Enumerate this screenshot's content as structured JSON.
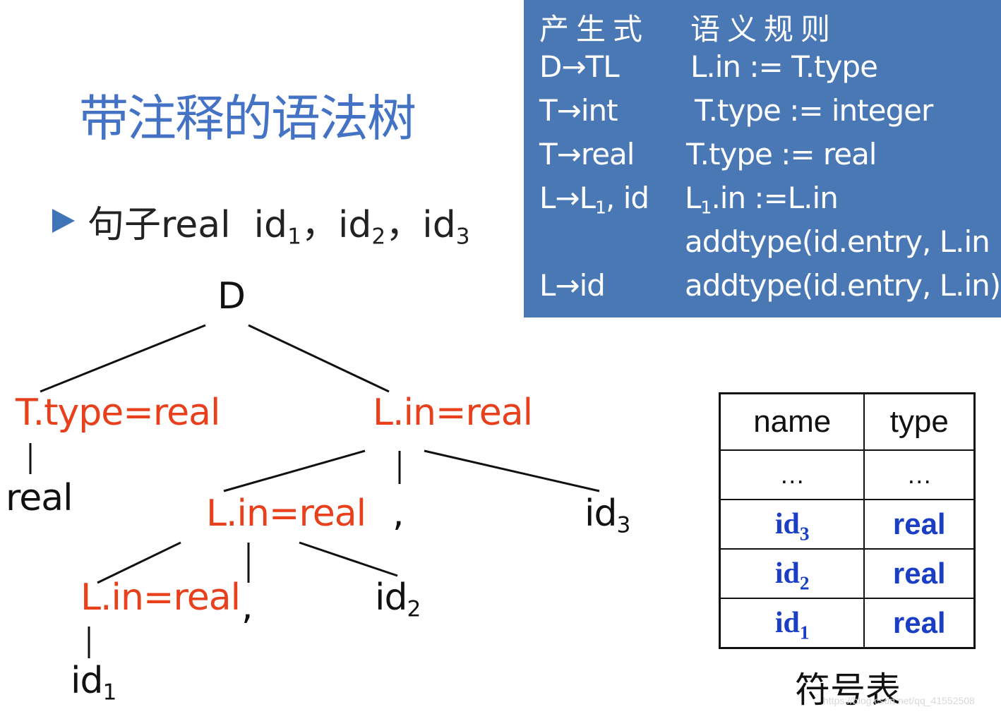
{
  "title": "带注释的语法树",
  "sentence": {
    "prefix": "句子real",
    "ids": [
      {
        "base": "id",
        "sub": "1",
        "sep": "，"
      },
      {
        "base": "id",
        "sub": "2",
        "sep": "，"
      },
      {
        "base": "id",
        "sub": "3",
        "sep": ""
      }
    ]
  },
  "rules_panel": {
    "header": {
      "production": "产生式",
      "semantic": "语义规则"
    },
    "rows": [
      {
        "production": "D→TL",
        "semantic": "L.in := T.type"
      },
      {
        "production": "T→int",
        "semantic": "T.type := integer"
      },
      {
        "production": "T→real",
        "semantic": "T.type := real"
      },
      {
        "production_pre": "L→L",
        "production_sub": "1",
        "production_post": ", id",
        "semantic_pre": "L",
        "semantic_sub": "1",
        "semantic_post": ".in :=L.in"
      },
      {
        "production": "",
        "semantic": "addtype(id.entry,  L.in"
      },
      {
        "production": "L→id",
        "semantic": "addtype(id.entry, L.in)"
      }
    ]
  },
  "tree": {
    "root": "D",
    "t_node": "T.type=real",
    "real_leaf": "real",
    "l_node_1": "L.in=real",
    "l_node_2": "L.in=real",
    "l_node_3": "L.in=real",
    "comma_1": ",",
    "comma_2": ",",
    "id1": {
      "base": "id",
      "sub": "1"
    },
    "id2": {
      "base": "id",
      "sub": "2"
    },
    "id3": {
      "base": "id",
      "sub": "3"
    }
  },
  "symbol_table": {
    "headers": [
      "name",
      "type"
    ],
    "rows": [
      {
        "name": "…",
        "name_sub": "",
        "type": "…"
      },
      {
        "name": "id",
        "name_sub": "3",
        "type": "real"
      },
      {
        "name": "id",
        "name_sub": "2",
        "type": "real"
      },
      {
        "name": "id",
        "name_sub": "1",
        "type": "real"
      }
    ],
    "caption": "符号表"
  },
  "colors": {
    "accent_blue": "#4472c4",
    "panel_blue": "#4a78b5",
    "annotation_red": "#e8401c",
    "table_blue": "#1a3fc4"
  },
  "watermark": "https://blog.csdn.net/qq_41552508"
}
